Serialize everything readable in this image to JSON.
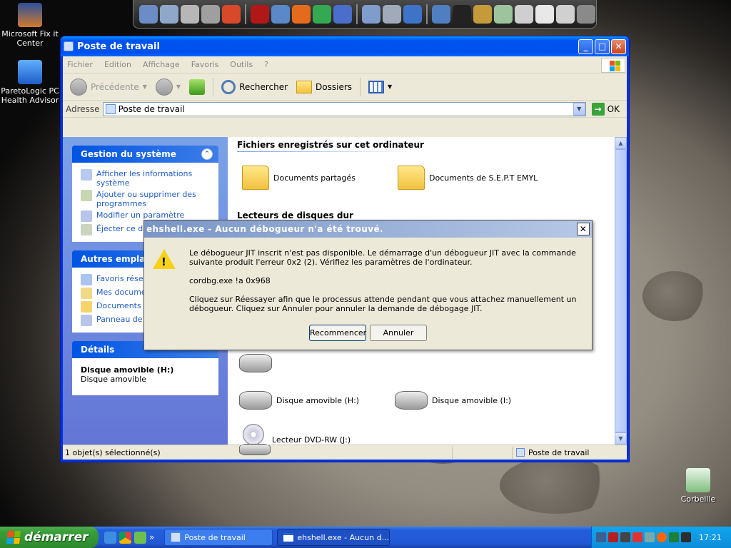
{
  "desktop": {
    "icons": [
      {
        "label": "Microsoft Fix it Center"
      },
      {
        "label": "ParetoLogic PC Health Advisor"
      },
      {
        "label": "Corbeille"
      }
    ]
  },
  "quick_bar": {
    "icons": [
      "folder-icon",
      "presentation-icon",
      "tools-icon",
      "tools-icon",
      "ccleaner-icon",
      "wifi-icon",
      "globe-icon",
      "firefox-icon",
      "chrome-icon",
      "help-icon",
      "folder-icon",
      "scanner-icon",
      "windows-icon",
      "network-icon",
      "shirt-icon",
      "tools-icon",
      "recycle-icon",
      "trash-icon",
      "window-icon",
      "window-icon",
      "printer-icon"
    ]
  },
  "window": {
    "title": "Poste de travail",
    "menu": [
      "Fichier",
      "Edition",
      "Affichage",
      "Favoris",
      "Outils",
      "?"
    ],
    "toolbar": {
      "back": "Précédente",
      "search": "Rechercher",
      "folders": "Dossiers"
    },
    "address": {
      "label": "Adresse",
      "value": "Poste de travail",
      "go": "OK"
    },
    "left_pane": {
      "system": {
        "title": "Gestion du système",
        "links": [
          "Afficher les informations système",
          "Ajouter ou supprimer des programmes",
          "Modifier un paramètre",
          "Éjecter ce disque"
        ]
      },
      "other": {
        "title": "Autres emplace",
        "links": [
          "Favoris résea",
          "Mes documen",
          "Documents pa",
          "Panneau de c"
        ]
      },
      "details": {
        "title": "Détails",
        "name": "Disque amovible (H:)",
        "type": "Disque amovible"
      }
    },
    "right_pane": {
      "section_files": "Fichiers enregistrés sur cet ordinateur",
      "files": [
        "Documents partagés",
        "Documents de S.E.P.T  EMYL"
      ],
      "section_drives": "Lecteurs de disques dur",
      "drives": [
        "Disque amovible (H:)",
        "Disque amovible (I:)",
        "Lecteur DVD-RW (J:)"
      ]
    },
    "status": {
      "left": "1 objet(s) sélectionné(s)",
      "right": "Poste de travail"
    }
  },
  "dialog": {
    "title": "ehshell.exe - Aucun débogueur n'a été trouvé.",
    "para1": "Le débogueur JIT inscrit n'est pas disponible. Le démarrage d'un débogueur JIT avec la commande suivante produit l'erreur 0x2 (2). Vérifiez les paramètres de l'ordinateur.",
    "para2": "cordbg.exe !a 0x968",
    "para3": "Cliquez sur Réessayer afin que le processus attende pendant que vous attachez manuellement un débogueur. Cliquez sur Annuler pour annuler la demande de débogage JIT.",
    "retry": "Recommencer",
    "cancel": "Annuler"
  },
  "taskbar": {
    "start": "démarrer",
    "tasks": [
      "Poste de travail",
      "ehshell.exe - Aucun d..."
    ],
    "clock": "17:21",
    "overflow": "»"
  },
  "colors": {
    "xp_blue": "#0054e3",
    "start_green": "#379c37",
    "tray_blue": "#0d8dd9"
  }
}
